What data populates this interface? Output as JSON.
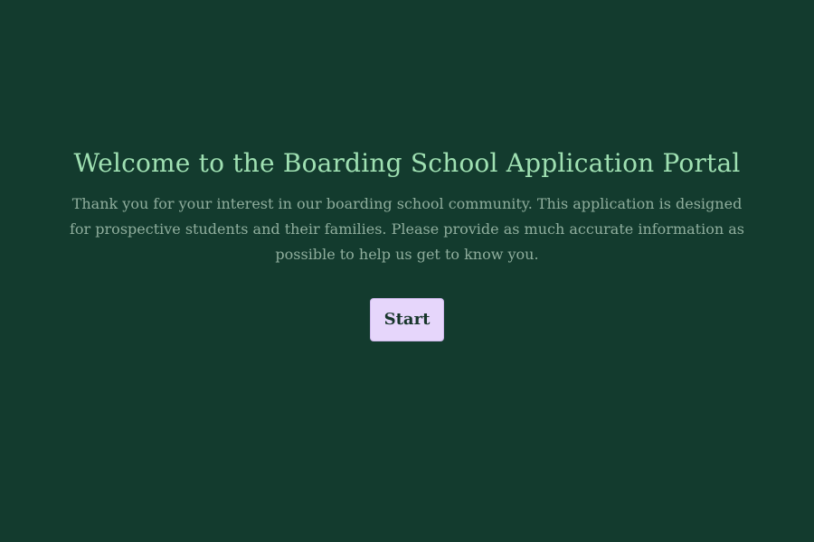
{
  "welcome": {
    "title": "Welcome to the Boarding School Application Portal",
    "intro": "Thank you for your interest in our boarding school community. This application is designed for prospective students and their families. Please provide as much accurate information as possible to help us get to know you.",
    "start_label": "Start"
  },
  "colors": {
    "background": "#133b2e",
    "title": "#9fe0b2",
    "body_text": "#8fae9d",
    "button_background": "#e6d6fb",
    "button_text": "#17352a"
  }
}
